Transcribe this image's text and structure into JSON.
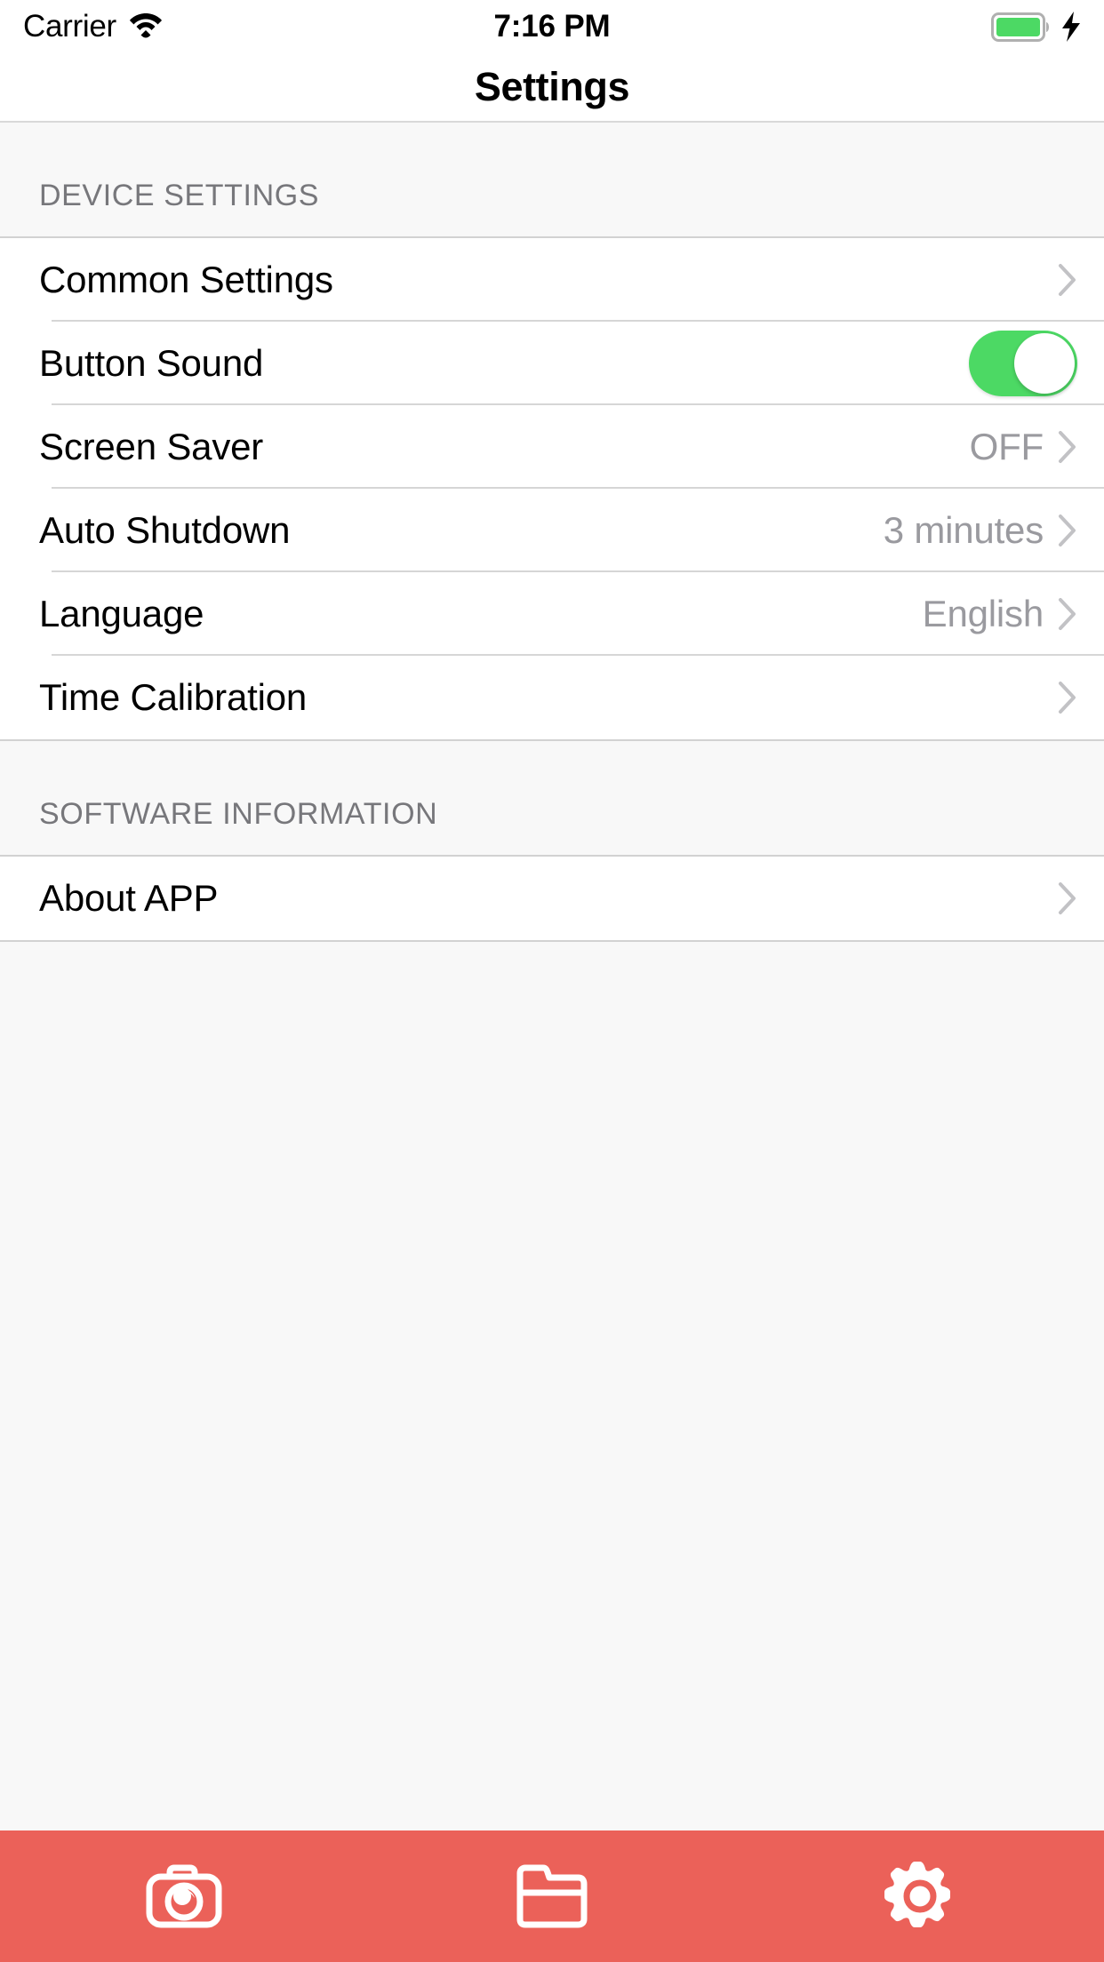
{
  "status_bar": {
    "carrier": "Carrier",
    "wifi_icon": "wifi-icon",
    "time": "7:16 PM",
    "battery_icon": "battery-full-icon",
    "charging_icon": "lightning-bolt-icon",
    "battery_color": "#4cd964"
  },
  "navbar": {
    "title": "Settings"
  },
  "sections": [
    {
      "header": "DEVICE SETTINGS",
      "rows": [
        {
          "label": "Common Settings",
          "value": "",
          "accessory": "chevron"
        },
        {
          "label": "Button Sound",
          "value": "",
          "accessory": "toggle",
          "toggle_on": true
        },
        {
          "label": "Screen Saver",
          "value": "OFF",
          "accessory": "chevron"
        },
        {
          "label": "Auto Shutdown",
          "value": "3 minutes",
          "accessory": "chevron"
        },
        {
          "label": "Language",
          "value": "English",
          "accessory": "chevron"
        },
        {
          "label": "Time Calibration",
          "value": "",
          "accessory": "chevron"
        }
      ]
    },
    {
      "header": "SOFTWARE INFORMATION",
      "rows": [
        {
          "label": "About APP",
          "value": "",
          "accessory": "chevron"
        }
      ]
    }
  ],
  "tabbar": {
    "background_color": "#eb6159",
    "tabs": [
      {
        "name": "camera",
        "icon": "camera-icon",
        "active": false
      },
      {
        "name": "folder",
        "icon": "folder-icon",
        "active": false
      },
      {
        "name": "settings",
        "icon": "gear-icon",
        "active": true
      }
    ]
  },
  "theme": {
    "accent": "#eb6159",
    "toggle_on": "#4cd964",
    "value_text": "#9a9a9f",
    "header_text": "#77777b",
    "group_bg": "#ffffff",
    "page_bg": "#f8f8f8"
  }
}
